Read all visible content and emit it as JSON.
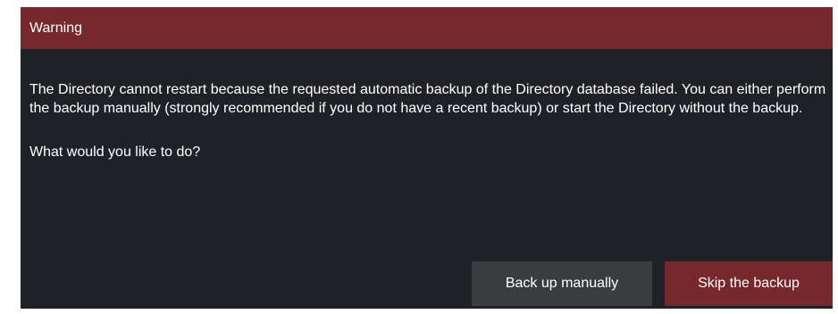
{
  "dialog": {
    "title": "Warning",
    "message": "The Directory cannot restart because the requested automatic backup of the Directory database failed. You can either perform the backup manually (strongly recommended if you do not have a recent backup) or start the Directory without the backup.",
    "question": "What would you like to do?",
    "buttons": {
      "backup_manually": "Back up manually",
      "skip_backup": "Skip the backup"
    }
  },
  "colors": {
    "title_bar": "#76282c",
    "background": "#1e2226",
    "secondary_button": "#3a3c3f",
    "primary_button": "#76282c",
    "text": "#ffffff"
  }
}
